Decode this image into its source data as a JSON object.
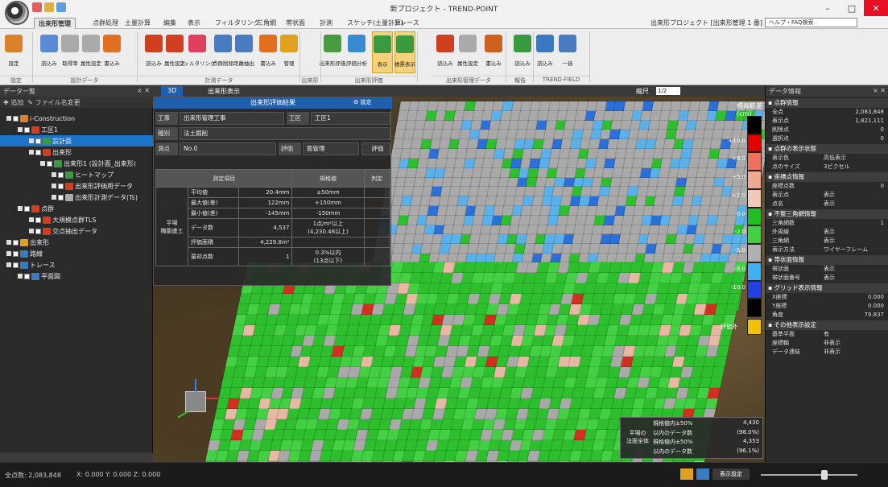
{
  "window": {
    "title": "新プロジェクト - TREND-POINT",
    "project_label": "出来形プロジェクト [出来形管理 1 番]",
    "help_placeholder": "ヘルプ・FAQ検索",
    "minimize": "–",
    "maximize": "□",
    "close": "✕"
  },
  "tabs": [
    "出来形管理",
    "点群処理",
    "土量計算",
    "編集",
    "表示",
    "フィルタリング",
    "三角網",
    "帯状面",
    "計測",
    "スケッチ(土量計算)",
    "トレース"
  ],
  "ribbon": {
    "buttons": [
      {
        "label": "設定",
        "color": "#d9822b"
      },
      {
        "label": "読込み",
        "color": "#5b8bd4"
      },
      {
        "label": "取得率",
        "color": "#aaaaaa"
      },
      {
        "label": "属性設定",
        "color": "#aaaaaa"
      },
      {
        "label": "書込み",
        "color": "#e07020"
      },
      {
        "label": "読込み",
        "color": "#d04020"
      },
      {
        "label": "属性設定",
        "color": "#d04020"
      },
      {
        "label": "フィルタリング",
        "color": "#e04060"
      },
      {
        "label": "点群削除",
        "color": "#4a7ac0"
      },
      {
        "label": "距離抽出",
        "color": "#4a7ac0"
      },
      {
        "label": "書込み",
        "color": "#e07020"
      },
      {
        "label": "管理",
        "color": "#e0a020"
      },
      {
        "label": "出来形評価",
        "color": "#4a9a40"
      },
      {
        "label": "評価分析",
        "color": "#3a8ad0"
      },
      {
        "label": "表示",
        "color": "#3a9a40"
      },
      {
        "label": "帳票表示",
        "color": "#3a9a40"
      },
      {
        "label": "読込み",
        "color": "#d04020"
      },
      {
        "label": "属性設定",
        "color": "#aaaaaa"
      },
      {
        "label": "書込み",
        "color": "#d06020"
      },
      {
        "label": "読込み",
        "color": "#3a9a40"
      },
      {
        "label": "読込み",
        "color": "#3a7ac0"
      },
      {
        "label": "一括",
        "color": "#4a7ac0"
      }
    ],
    "groups": [
      "設定",
      "設計データ",
      "計測データ",
      "出来形管理",
      "出来形評価",
      "出来形管理データ",
      "報告",
      "TREND-FIELD"
    ]
  },
  "left_panel": {
    "title": "データ一覧",
    "toolbar_new": "追加",
    "toolbar_edit": "ファイル名変更",
    "close": "× ✕",
    "tree": [
      {
        "level": 0,
        "label": "i-Construction",
        "icon": "#d9822b",
        "selected": false
      },
      {
        "level": 1,
        "label": "工区1",
        "icon": "#d04020",
        "selected": false
      },
      {
        "level": 2,
        "label": "設計面",
        "icon": "#3a9a40",
        "selected": true
      },
      {
        "level": 2,
        "label": "出来形",
        "icon": "#d04020",
        "selected": false
      },
      {
        "level": 3,
        "label": "出来形1 (設計面_出来形)",
        "icon": "#3a9a40",
        "selected": false
      },
      {
        "level": 4,
        "label": "ヒートマップ",
        "icon": "#3a9a40",
        "selected": false
      },
      {
        "level": 4,
        "label": "出来形評価用データ",
        "icon": "#d04020",
        "selected": false
      },
      {
        "level": 4,
        "label": "出来形計測データ(Ts)",
        "icon": "#aaaaaa",
        "selected": false
      },
      {
        "level": 1,
        "label": "点群",
        "icon": "#d04020",
        "selected": false
      },
      {
        "level": 2,
        "label": "大規模点群TLS",
        "icon": "#d04020",
        "selected": false
      },
      {
        "level": 2,
        "label": "交点抽出データ",
        "icon": "#d04020",
        "selected": false
      },
      {
        "level": 0,
        "label": "出来形",
        "icon": "#e0a020",
        "selected": false
      },
      {
        "level": 0,
        "label": "路線",
        "icon": "#3a7ac0",
        "selected": false
      },
      {
        "level": 0,
        "label": "トレース",
        "icon": "#3a7ac0",
        "selected": false
      },
      {
        "level": 1,
        "label": "平面図",
        "icon": "#3a7ac0",
        "selected": false
      }
    ]
  },
  "viewport": {
    "tabs": [
      "3D",
      "出来形表示"
    ],
    "scale_label": "縮尺",
    "scale_value": "1/2",
    "legend_title": "標高較差(cm)",
    "legend": [
      {
        "label": "",
        "color": "#000000"
      },
      {
        "label": "+10.0",
        "color": "#e00000"
      },
      {
        "label": "+8.0",
        "color": "#f07060"
      },
      {
        "label": "+5.0",
        "color": "#f0a890"
      },
      {
        "label": "+2.0",
        "color": "#f0c8b8"
      },
      {
        "label": "0.0",
        "color": "#20c020"
      },
      {
        "label": "-2.0",
        "color": "#40d040"
      },
      {
        "label": "-5.0",
        "color": "#b0b0b0"
      },
      {
        "label": "-8.0",
        "color": "#40b0f0"
      },
      {
        "label": "-10.0",
        "color": "#2040e0"
      },
      {
        "label": "",
        "color": "#000000"
      }
    ],
    "na_label": "評価外",
    "result": {
      "title": "出来形評価結果",
      "settings": "設定",
      "fields": [
        {
          "label": "工事",
          "value": "出来形管理工事",
          "label2": "工区",
          "value2": "工区1"
        },
        {
          "label": "種別",
          "value": "法土掘削"
        },
        {
          "label": "測点",
          "value": "No.0",
          "label2": "評価",
          "value2": "面管理",
          "extra": "評価"
        }
      ],
      "headers": [
        "測定項目",
        "規格値",
        "判定"
      ],
      "group_label": "平場\n機能盛土",
      "rows": [
        {
          "item": "平均値",
          "measured": "20.4mm",
          "spec": "±50mm",
          "judge": ""
        },
        {
          "item": "最大値(差)",
          "measured": "122mm",
          "spec": "+150mm",
          "judge": ""
        },
        {
          "item": "最小値(差)",
          "measured": "-145mm",
          "spec": "-150mm",
          "judge": ""
        },
        {
          "item": "データ数",
          "measured": "4,537",
          "spec": "1点/m²以上\n(4,230.48以上)",
          "judge": ""
        },
        {
          "item": "評価面積",
          "measured": "4,229.8m²",
          "spec": "",
          "judge": ""
        },
        {
          "item": "棄却点数",
          "measured": "1",
          "spec": "0.3%以内\n(13点以下)",
          "judge": ""
        }
      ]
    },
    "summary": {
      "label": "平場の\n法面全体",
      "rows": [
        {
          "k": "規格値内±50%",
          "v": "4,430"
        },
        {
          "k": "以内のデータ数",
          "v": "(98.0%)"
        },
        {
          "k": "規格値内±50%",
          "v": "4,353"
        },
        {
          "k": "以内のデータ数",
          "v": "(96.1%)"
        }
      ]
    }
  },
  "right_panel": {
    "title": "データ情報",
    "sections": [
      {
        "title": "点群情報",
        "rows": [
          [
            "全点",
            "2,083,848"
          ],
          [
            "表示点",
            "1,821,111"
          ],
          [
            "削除点",
            "0"
          ],
          [
            "選択点",
            "0"
          ]
        ]
      },
      {
        "title": "点群の表示状態",
        "rows": [
          [
            "表示色",
            "高低表示"
          ],
          [
            "点のサイズ",
            "3ピクセル"
          ]
        ]
      },
      {
        "title": "座標点情報",
        "rows": [
          [
            "座標点数",
            "0"
          ],
          [
            "表示点",
            "表示"
          ],
          [
            "点名",
            "表示"
          ]
        ]
      },
      {
        "title": "不整三角網情報",
        "rows": [
          [
            "三角網数",
            "1"
          ],
          [
            "外周線",
            "表示"
          ],
          [
            "三角網",
            "表示"
          ],
          [
            "表示方法",
            "ワイヤーフレーム"
          ]
        ]
      },
      {
        "title": "帯状面情報",
        "rows": [
          [
            "帯状面",
            "表示"
          ],
          [
            "帯状面番号",
            "表示"
          ]
        ]
      },
      {
        "title": "グリッド表示情報",
        "rows": [
          [
            "X座標",
            "0.000"
          ],
          [
            "Y座標",
            "0.000"
          ],
          [
            "角度",
            "79.837"
          ]
        ]
      },
      {
        "title": "その他表示設定",
        "rows": [
          [
            "基準平面",
            "有"
          ],
          [
            "座標軸",
            "非表示"
          ],
          [
            "データ連結",
            "非表示"
          ]
        ]
      }
    ]
  },
  "status": {
    "points": "全点数: 2,083,848",
    "coords": "X: 0.000  Y: 0.000  Z: 0.000",
    "display_setting": "表示設定"
  },
  "colors": {
    "accent": "#1f5fb0",
    "selected": "#1b74c9",
    "close_button": "#e81123",
    "field_green": "#2dbf2d",
    "field_gray": "#a9a9a9"
  }
}
